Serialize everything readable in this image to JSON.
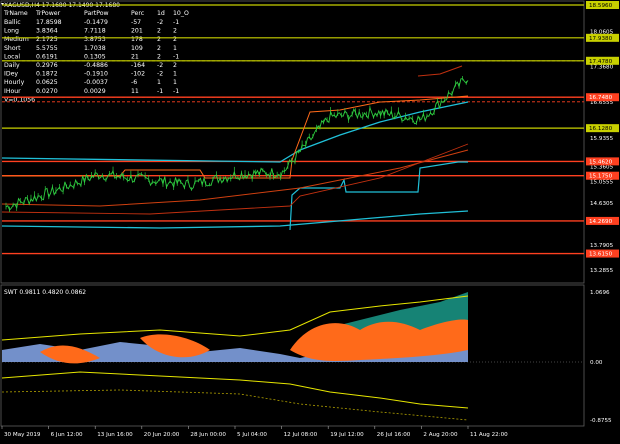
{
  "window": {
    "title": "XAGUSD,H4 17.1680 17.1490 17.1680"
  },
  "info_table": {
    "headers": [
      "TrName",
      "TrPower",
      "PartPow",
      "Perc",
      "1d",
      "10_O"
    ],
    "rows": [
      [
        "Ballic",
        "17.8598",
        "-0.1479",
        "-57",
        "-2",
        "-1"
      ],
      [
        "Long",
        "3.8364",
        "7.7118",
        "201",
        "2",
        "2"
      ],
      [
        "Medium",
        "2.1725",
        "3.8753",
        "178",
        "2",
        "2"
      ],
      [
        "Short",
        "5.5755",
        "1.7038",
        "109",
        "2",
        "1"
      ],
      [
        "Local",
        "0.6191",
        "0.1305",
        "21",
        "2",
        "-1"
      ],
      [
        "Daily",
        "0.2976",
        "-0.4886",
        "-164",
        "-2",
        "2"
      ],
      [
        "IDey",
        "0.1872",
        "-0.1910",
        "-102",
        "-2",
        "1"
      ],
      [
        "Hourly",
        "0.0625",
        "-0.0037",
        "-6",
        "1",
        "1"
      ],
      [
        "IHour",
        "0.0270",
        "0.0029",
        "11",
        "-1",
        "-1"
      ]
    ],
    "footer": "V=0.1056"
  },
  "price_axis": {
    "ticks": [
      "18.5960",
      "18.0605",
      "17.9380",
      "17.4780",
      "17.3680",
      "16.7480",
      "16.6555",
      "16.1280",
      "15.9355",
      "15.4620",
      "15.3605",
      "15.1750",
      "15.0555",
      "14.6305",
      "14.2690",
      "13.7905",
      "13.6150",
      "13.2855"
    ],
    "boxed": [
      {
        "label": "18.5960",
        "color": "#c8d000"
      },
      {
        "label": "17.9380",
        "color": "#c8d000"
      },
      {
        "label": "17.4780",
        "color": "#c8d000"
      },
      {
        "label": "16.7480",
        "color": "#ff4020"
      },
      {
        "label": "16.1280",
        "color": "#c8d000"
      },
      {
        "label": "15.4620",
        "color": "#ff4020"
      },
      {
        "label": "15.1750",
        "color": "#ff4020"
      },
      {
        "label": "14.2690",
        "color": "#ff4020"
      },
      {
        "label": "13.6150",
        "color": "#ff4020"
      }
    ]
  },
  "oscillator": {
    "title": "SWT 0.9811 0.4820 0.0862",
    "axis_ticks": [
      "1.0696",
      "0.00",
      "-0.8755"
    ]
  },
  "time_axis": {
    "labels": [
      "30 May 2019",
      "6 Jun 12:00",
      "13 Jun 16:00",
      "20 Jun 20:00",
      "28 Jun 00:00",
      "5 Jul 04:00",
      "12 Jul 08:00",
      "19 Jul 12:00",
      "26 Jul 16:00",
      "2 Aug 20:00",
      "11 Aug 22:00"
    ]
  },
  "chart_data": {
    "type": "line",
    "title": "XAGUSD,H4",
    "xlabel": "",
    "ylabel": "",
    "ylim": [
      13.2855,
      18.596
    ],
    "x": [
      "30 May 2019",
      "6 Jun 12:00",
      "13 Jun 16:00",
      "20 Jun 20:00",
      "28 Jun 00:00",
      "5 Jul 04:00",
      "12 Jul 08:00",
      "19 Jul 12:00",
      "26 Jul 16:00",
      "2 Aug 20:00",
      "11 Aug 22:00"
    ],
    "series": [
      {
        "values": [
          14.55,
          14.85,
          15.2,
          15.1,
          15.0,
          15.2,
          15.25,
          16.35,
          16.45,
          16.3,
          17.15
        ]
      }
    ],
    "levels": [
      18.596,
      17.938,
      17.478,
      16.748,
      16.128,
      15.462,
      15.175,
      14.269,
      13.615
    ],
    "colors": {
      "price": "#2ecc40",
      "support": "#ff4020",
      "resistance": "#c8d000",
      "cyan": "#20c0d8",
      "orange": "#ff6a1a",
      "blue_area": "#7fa0e0",
      "teal_area": "#1a9a8a"
    }
  }
}
